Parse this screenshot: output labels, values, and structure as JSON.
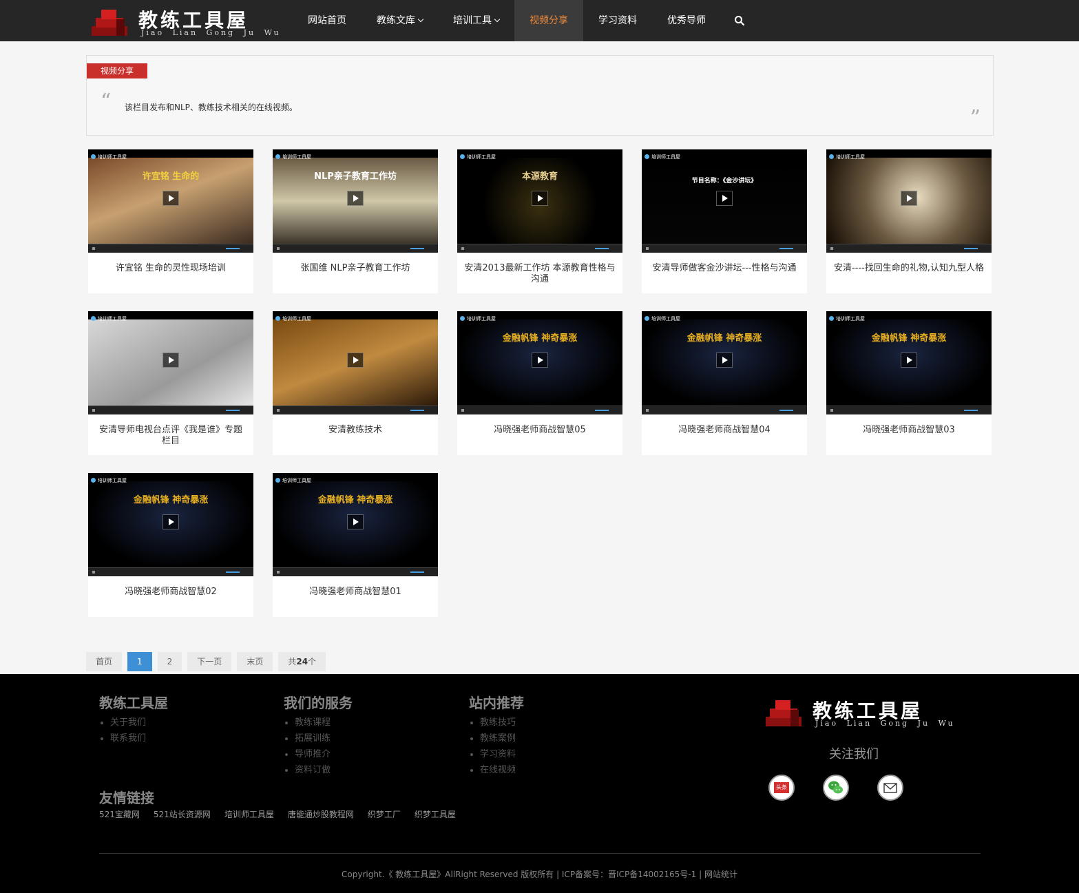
{
  "header": {
    "logo_title": "教练工具屋",
    "logo_subtitle": "Jiao Lian Gong Ju Wu",
    "nav": [
      {
        "label": "网站首页",
        "has_dropdown": false,
        "active": false
      },
      {
        "label": "教练文库",
        "has_dropdown": true,
        "active": false
      },
      {
        "label": "培训工具",
        "has_dropdown": true,
        "active": false
      },
      {
        "label": "视频分享",
        "has_dropdown": false,
        "active": true
      },
      {
        "label": "学习资料",
        "has_dropdown": false,
        "active": false
      },
      {
        "label": "优秀导师",
        "has_dropdown": false,
        "active": false
      }
    ],
    "search_icon": "search-icon",
    "accent_color": "#f08a3c"
  },
  "intro": {
    "tag": "视频分享",
    "text": "该栏目发布和NLP、教练技术相关的在线视频。",
    "tag_color": "#c9302c"
  },
  "videos": [
    {
      "title": "许宜铭 生命的灵性现场培训",
      "thumb_caption": "许宜铭 生命的"
    },
    {
      "title": "张国维 NLP亲子教育工作坊",
      "thumb_caption": "NLP亲子教育工作坊"
    },
    {
      "title": "安清2013最新工作坊 本源教育性格与沟通",
      "thumb_caption": "本源教育"
    },
    {
      "title": "安清导师做客金沙讲坛---性格与沟通",
      "thumb_caption": "节目名称：《金沙讲坛》"
    },
    {
      "title": "安清----找回生命的礼物,认知九型人格",
      "thumb_caption": ""
    },
    {
      "title": "安清导师电视台点评《我是谁》专题栏目",
      "thumb_caption": ""
    },
    {
      "title": "安清教练技术",
      "thumb_caption": ""
    },
    {
      "title": "冯晓强老师商战智慧05",
      "thumb_caption": "金融帆锋 神奇暴涨"
    },
    {
      "title": "冯晓强老师商战智慧04",
      "thumb_caption": "金融帆锋 神奇暴涨"
    },
    {
      "title": "冯晓强老师商战智慧03",
      "thumb_caption": "金融帆锋 神奇暴涨"
    },
    {
      "title": "冯晓强老师商战智慧02",
      "thumb_caption": "金融帆锋 神奇暴涨"
    },
    {
      "title": "冯晓强老师商战智慧01",
      "thumb_caption": "金融帆锋 神奇暴涨"
    }
  ],
  "thumb_brand": "培训师工具屋",
  "pager": {
    "first": "首页",
    "pages": [
      "1",
      "2"
    ],
    "current": "1",
    "next": "下一页",
    "last": "末页",
    "total_prefix": "共",
    "total_count": "24",
    "total_suffix": "个",
    "current_color": "#3d8fd6"
  },
  "footer": {
    "cols": [
      {
        "title": "教练工具屋",
        "items": [
          "关于我们",
          "联系我们"
        ]
      },
      {
        "title": "我们的服务",
        "items": [
          "教练课程",
          "拓展训练",
          "导师推介",
          "资料订做"
        ]
      },
      {
        "title": "站内推荐",
        "items": [
          "教练技巧",
          "教练案例",
          "学习资料",
          "在线视频"
        ]
      }
    ],
    "friend_title": "友情链接",
    "friend_links": [
      "521宝藏网",
      "521站长资源网",
      "培训师工具屋",
      "唐能通炒股教程网",
      "织梦工厂",
      "织梦工具屋"
    ],
    "logo_title": "教练工具屋",
    "logo_subtitle": "Jiao Lian Gong Ju Wu",
    "follow": "关注我们",
    "social": [
      {
        "name": "toutiao-icon",
        "label": "头条"
      },
      {
        "name": "wechat-icon",
        "label": ""
      },
      {
        "name": "email-icon",
        "label": ""
      }
    ],
    "copyright": "Copyright.《 教练工具屋》AllRight Reserved 版权所有 | ICP备案号：晋ICP备14002165号-1 | 网站统计"
  }
}
